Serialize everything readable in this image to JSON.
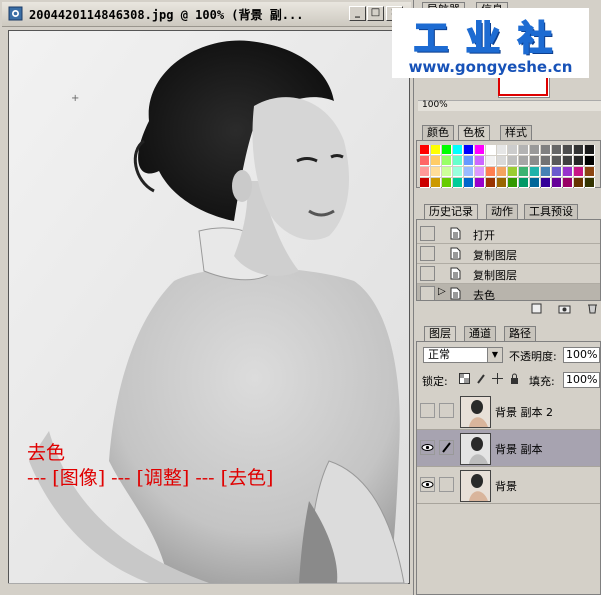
{
  "window": {
    "title": "2004420114846308.jpg @ 100% (背景 副...",
    "minimize_glyph": "_",
    "maximize_glyph": "□",
    "close_glyph": "×"
  },
  "caption": {
    "line1": "去色",
    "line2": "--- [图像] --- [调整] --- [去色]"
  },
  "logo": {
    "name": "工业社",
    "url": "www.gongyeshe.cn"
  },
  "navigator": {
    "tabs": [
      "导航器",
      "信息"
    ],
    "zoom": "100%"
  },
  "color_panel": {
    "tabs": [
      "颜色",
      "色板",
      "样式"
    ],
    "active_tab": "色板",
    "swatch_rows": [
      [
        "#ff0000",
        "#ffff00",
        "#00ff00",
        "#00ffff",
        "#0000ff",
        "#ff00ff",
        "#ffffff",
        "#e6e6e6",
        "#cccccc",
        "#b3b3b3",
        "#999999",
        "#808080",
        "#666666",
        "#4d4d4d",
        "#333333",
        "#1a1a1a"
      ],
      [
        "#ff6666",
        "#ffcc66",
        "#99ff66",
        "#66ffcc",
        "#6699ff",
        "#cc66ff",
        "#f2f2f2",
        "#d9d9d9",
        "#bfbfbf",
        "#a6a6a6",
        "#8c8c8c",
        "#737373",
        "#595959",
        "#404040",
        "#262626",
        "#000000"
      ],
      [
        "#ff9999",
        "#ffdd99",
        "#ccff99",
        "#99ffdd",
        "#99bbff",
        "#dd99ff",
        "#ff7f50",
        "#f4a460",
        "#9acd32",
        "#3cb371",
        "#20b2aa",
        "#4682b4",
        "#6a5acd",
        "#9932cc",
        "#c71585",
        "#8b4513"
      ],
      [
        "#cc0000",
        "#cc9900",
        "#66cc00",
        "#00cc99",
        "#0066cc",
        "#9900cc",
        "#993300",
        "#996600",
        "#339900",
        "#009966",
        "#006699",
        "#330099",
        "#660099",
        "#990066",
        "#663300",
        "#333300"
      ]
    ]
  },
  "history_panel": {
    "tabs": [
      "历史记录",
      "动作",
      "工具预设"
    ],
    "active_tab": "历史记录",
    "items": [
      {
        "label": "打开"
      },
      {
        "label": "复制图层"
      },
      {
        "label": "复制图层"
      },
      {
        "label": "去色"
      }
    ]
  },
  "layers_panel": {
    "tabs": [
      "图层",
      "通道",
      "路径"
    ],
    "active_tab": "图层",
    "blend_mode": "正常",
    "opacity_label": "不透明度:",
    "opacity_value": "100%",
    "lock_label": "锁定:",
    "fill_label": "填充:",
    "fill_value": "100%",
    "layers": [
      {
        "name": "背景 副本 2",
        "visible": false,
        "selected": false
      },
      {
        "name": "背景 副本",
        "visible": true,
        "selected": true
      },
      {
        "name": "背景",
        "visible": true,
        "selected": false
      }
    ]
  }
}
